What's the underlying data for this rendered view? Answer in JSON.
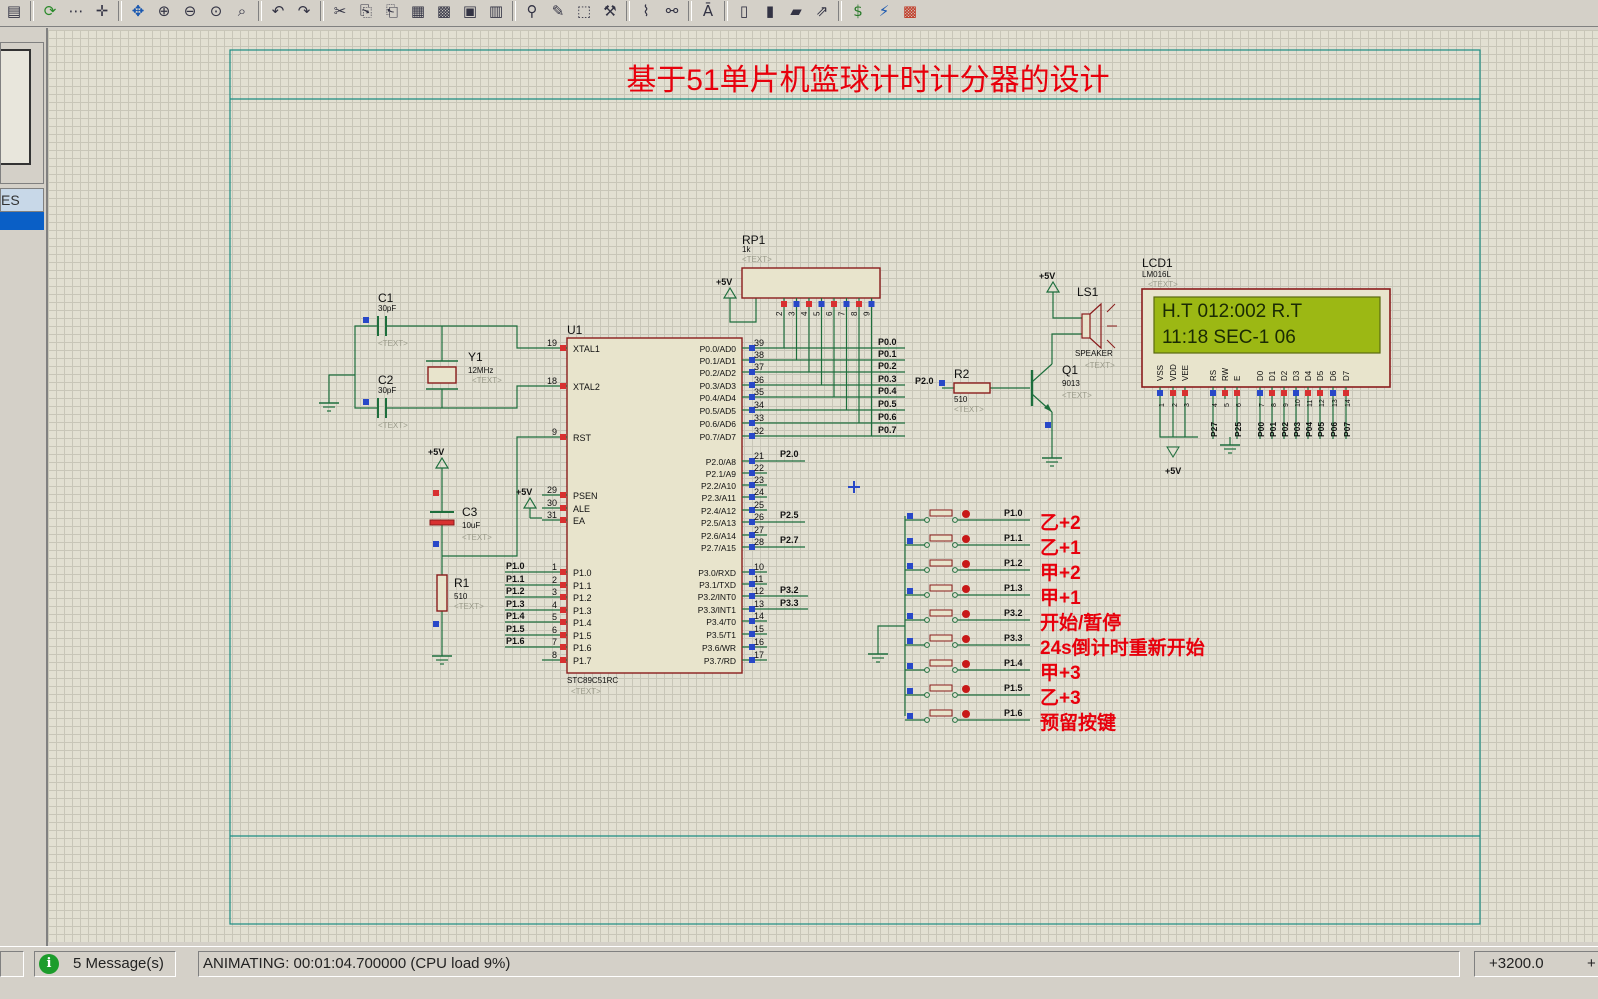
{
  "toolbar": {
    "icons": [
      "page-icon",
      "refresh-icon",
      "grid-icon",
      "origin-icon",
      "pan-icon",
      "zoom-in-icon",
      "zoom-out-icon",
      "zoom-all-icon",
      "zoom-area-icon",
      "undo-icon",
      "redo-icon",
      "cut-icon",
      "copy-icon",
      "paste-icon",
      "block-copy-icon",
      "block-move-icon",
      "block-rotate-icon",
      "block-delete-icon",
      "pick-device-icon",
      "make-device-icon",
      "package-icon",
      "decompose-icon",
      "wire-autorouter-icon",
      "search-icon",
      "property-assign-icon",
      "new-sheet-icon",
      "remove-sheet-icon",
      "goto-sheet-icon",
      "export-icon",
      "bill-of-materials-icon",
      "electrical-check-icon",
      "ares-icon"
    ]
  },
  "left_panel": {
    "devices_header": "ES"
  },
  "schematic": {
    "title": "基于51单片机篮球计时计分器的设计",
    "title_color": "#e8000c",
    "components": {
      "c1": {
        "ref": "C1",
        "value": "30pF",
        "text": "<TEXT>"
      },
      "c2": {
        "ref": "C2",
        "value": "30pF",
        "text": "<TEXT>"
      },
      "y1": {
        "ref": "Y1",
        "value": "12MHz",
        "text": "<TEXT>"
      },
      "c3": {
        "ref": "C3",
        "value": "10uF",
        "text": "<TEXT>"
      },
      "r1": {
        "ref": "R1",
        "value": "510",
        "text": "<TEXT>"
      },
      "rp1": {
        "ref": "RP1",
        "value": "1k",
        "text": "<TEXT>"
      },
      "u1": {
        "ref": "U1",
        "part": "STC89C51RC",
        "text": "<TEXT>"
      },
      "r2": {
        "ref": "R2",
        "value": "510",
        "text": "<TEXT>"
      },
      "q1": {
        "ref": "Q1",
        "value": "9013",
        "text": "<TEXT>"
      },
      "ls1": {
        "ref": "LS1",
        "value": "SPEAKER",
        "text": "<TEXT>"
      },
      "lcd1": {
        "ref": "LCD1",
        "part": "LM016L",
        "text": "<TEXT>"
      }
    },
    "power_labels": {
      "vcc": "+5V"
    },
    "u1_left_pins": [
      {
        "num": "19",
        "name": "XTAL1"
      },
      {
        "num": "18",
        "name": "XTAL2"
      },
      {
        "num": "9",
        "name": "RST"
      },
      {
        "num": "29",
        "name": "PSEN"
      },
      {
        "num": "30",
        "name": "ALE"
      },
      {
        "num": "31",
        "name": "EA"
      },
      {
        "num": "1",
        "name": "P1.0"
      },
      {
        "num": "2",
        "name": "P1.1"
      },
      {
        "num": "3",
        "name": "P1.2"
      },
      {
        "num": "4",
        "name": "P1.3"
      },
      {
        "num": "5",
        "name": "P1.4"
      },
      {
        "num": "6",
        "name": "P1.5"
      },
      {
        "num": "7",
        "name": "P1.6"
      },
      {
        "num": "8",
        "name": "P1.7"
      }
    ],
    "u1_right_pins": [
      {
        "num": "39",
        "name": "P0.0/AD0"
      },
      {
        "num": "38",
        "name": "P0.1/AD1"
      },
      {
        "num": "37",
        "name": "P0.2/AD2"
      },
      {
        "num": "36",
        "name": "P0.3/AD3"
      },
      {
        "num": "35",
        "name": "P0.4/AD4"
      },
      {
        "num": "34",
        "name": "P0.5/AD5"
      },
      {
        "num": "33",
        "name": "P0.6/AD6"
      },
      {
        "num": "32",
        "name": "P0.7/AD7"
      },
      {
        "num": "21",
        "name": "P2.0/A8"
      },
      {
        "num": "22",
        "name": "P2.1/A9"
      },
      {
        "num": "23",
        "name": "P2.2/A10"
      },
      {
        "num": "24",
        "name": "P2.3/A11"
      },
      {
        "num": "25",
        "name": "P2.4/A12"
      },
      {
        "num": "26",
        "name": "P2.5/A13"
      },
      {
        "num": "27",
        "name": "P2.6/A14"
      },
      {
        "num": "28",
        "name": "P2.7/A15"
      },
      {
        "num": "10",
        "name": "P3.0/RXD"
      },
      {
        "num": "11",
        "name": "P3.1/TXD"
      },
      {
        "num": "12",
        "name": "P3.2/INT0"
      },
      {
        "num": "13",
        "name": "P3.3/INT1"
      },
      {
        "num": "14",
        "name": "P3.4/T0"
      },
      {
        "num": "15",
        "name": "P3.5/T1"
      },
      {
        "num": "16",
        "name": "P3.6/WR"
      },
      {
        "num": "17",
        "name": "P3.7/RD"
      }
    ],
    "p1_net_labels": [
      "P1.0",
      "P1.1",
      "P1.2",
      "P1.3",
      "P1.4",
      "P1.5",
      "P1.6"
    ],
    "p0_net_labels": [
      "P0.0",
      "P0.1",
      "P0.2",
      "P0.3",
      "P0.4",
      "P0.5",
      "P0.6",
      "P0.7"
    ],
    "p2_net_labels": [
      "P2.0",
      "P2.5",
      "P2.7"
    ],
    "p3_net_labels": [
      "P3.2",
      "P3.3"
    ],
    "rp1_pins": [
      "2",
      "3",
      "4",
      "5",
      "6",
      "7",
      "8",
      "9"
    ],
    "lcd_pins": [
      {
        "num": "1",
        "name": "VSS"
      },
      {
        "num": "2",
        "name": "VDD"
      },
      {
        "num": "3",
        "name": "VEE"
      },
      {
        "num": "4",
        "name": "RS"
      },
      {
        "num": "5",
        "name": "RW"
      },
      {
        "num": "6",
        "name": "E"
      },
      {
        "num": "7",
        "name": "D0"
      },
      {
        "num": "8",
        "name": "D1"
      },
      {
        "num": "9",
        "name": "D2"
      },
      {
        "num": "10",
        "name": "D3"
      },
      {
        "num": "11",
        "name": "D4"
      },
      {
        "num": "12",
        "name": "D5"
      },
      {
        "num": "13",
        "name": "D6"
      },
      {
        "num": "14",
        "name": "D7"
      }
    ],
    "lcd_net_labels": [
      "P27",
      "P25",
      "P00",
      "P01",
      "P02",
      "P03",
      "P04",
      "P05",
      "P06",
      "P07"
    ],
    "lcd_display": {
      "line1": "H.T 012:002 R.T",
      "line2": "11:18  SEC-1  06"
    },
    "r2_net": "P2.0",
    "buttons": [
      {
        "net": "P1.0",
        "label": "乙+2"
      },
      {
        "net": "P1.1",
        "label": "乙+1"
      },
      {
        "net": "P1.2",
        "label": "甲+2"
      },
      {
        "net": "P1.3",
        "label": "甲+1"
      },
      {
        "net": "P3.2",
        "label": "开始/暂停"
      },
      {
        "net": "P3.3",
        "label": "24s倒计时重新开始"
      },
      {
        "net": "P1.4",
        "label": "甲+3"
      },
      {
        "net": "P1.5",
        "label": "乙+3"
      },
      {
        "net": "P1.6",
        "label": "预留按键"
      }
    ],
    "button_label_color": "#e8000c"
  },
  "status_bar": {
    "messages": "5 Message(s)",
    "animating": "ANIMATING: 00:01:04.700000 (CPU load 9%)",
    "coordinates": "+3200.0",
    "trailing": "+"
  }
}
